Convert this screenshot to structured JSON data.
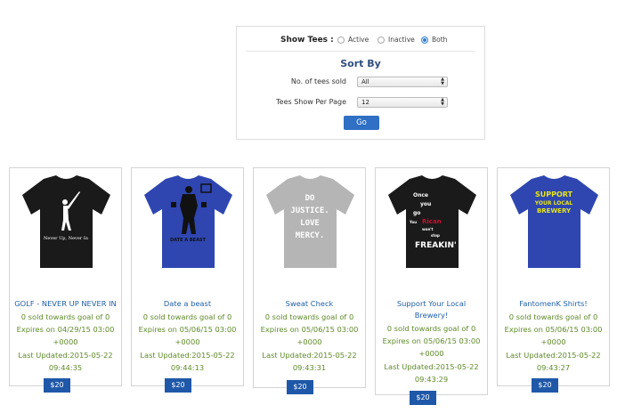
{
  "filter": {
    "show_label": "Show Tees :",
    "options": [
      "Active",
      "Inactive",
      "Both"
    ],
    "selected": "Both",
    "sort_title": "Sort By",
    "sold_label": "No. of tees sold",
    "sold_value": "All",
    "per_page_label": "Tees Show Per Page",
    "per_page_value": "12",
    "go_label": "Go"
  },
  "products": [
    {
      "title_lines": [
        "GOLF - NEVER UP NEVER IN"
      ],
      "sold": "0 sold towards goal of 0",
      "expires_1": "Expires on 04/29/15 03:00",
      "expires_2": "+0000",
      "updated_1": "Last Updated:2015-05-22",
      "updated_2": "09:44:35",
      "price": "$20",
      "shirt_color": "#1a1a1a",
      "design_text": "Never Up, Never In"
    },
    {
      "title_lines": [
        "Date a beast"
      ],
      "sold": "0 sold towards goal of 0",
      "expires_1": "Expires on 05/06/15 03:00",
      "expires_2": "+0000",
      "updated_1": "Last Updated:2015-05-22",
      "updated_2": "09:44:13",
      "price": "$20",
      "shirt_color": "#2f46b0",
      "design_text": "DATE A BEAST"
    },
    {
      "title_lines": [
        "Sweat Check"
      ],
      "sold": "0 sold towards goal of 0",
      "expires_1": "Expires on 05/06/15 03:00",
      "expires_2": "+0000",
      "updated_1": "Last Updated:2015-05-22",
      "updated_2": "09:43:31",
      "price": "$20",
      "shirt_color": "#b5b5b5",
      "design_lines": [
        "DO",
        "JUSTICE.",
        "LOVE",
        "MERCY."
      ]
    },
    {
      "title_lines": [
        "Support Your Local",
        "Brewery!"
      ],
      "sold": "0 sold towards goal of 0",
      "expires_1": "Expires on 05/06/15 03:00",
      "expires_2": "+0000",
      "updated_1": "Last Updated:2015-05-22",
      "updated_2": "09:43:29",
      "price": "$20",
      "shirt_color": "#1a1a1a",
      "design_lines": [
        "Once",
        "you",
        "go",
        "You",
        "Rican",
        "won't",
        "stop",
        "FREAKIN'"
      ]
    },
    {
      "title_lines": [
        "FantomenK Shirts!"
      ],
      "sold": "0 sold towards goal of 0",
      "expires_1": "Expires on 05/06/15 03:00",
      "expires_2": "+0000",
      "updated_1": "Last Updated:2015-05-22",
      "updated_2": "09:43:27",
      "price": "$20",
      "shirt_color": "#2f46b0",
      "design_lines": [
        "SUPPORT",
        "YOUR LOCAL",
        "BREWERY"
      ]
    }
  ]
}
